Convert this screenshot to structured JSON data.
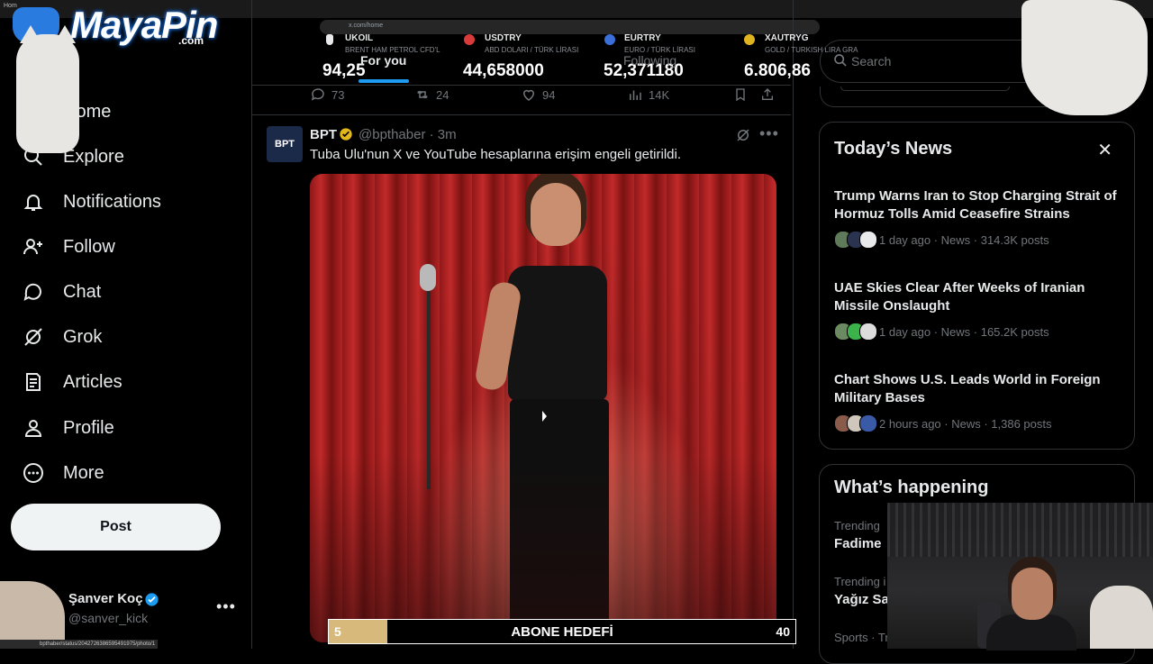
{
  "browser": {
    "tab_title": "Hom",
    "url": "x.com/home"
  },
  "overlay": {
    "logo_text": "MayaPin",
    "logo_sub": ".com",
    "goal": {
      "start": "5",
      "label": "ABONE HEDEFİ",
      "end": "40",
      "progress": 0.125
    },
    "status_url": "bpthaber/status/2042726386595491975/photo/1"
  },
  "tickers": [
    {
      "symbol": "UKOIL",
      "sub": "BRENT HAM PETROL CFD'L",
      "value": "94,25",
      "color": "#e7e9ea"
    },
    {
      "symbol": "USDTRY",
      "sub": "ABD DOLARI / TÜRK LİRASI",
      "value": "44,658000",
      "color": "#d93a3a"
    },
    {
      "symbol": "EURTRY",
      "sub": "EURO / TÜRK LİRASI",
      "value": "52,371180",
      "color": "#3a6fd9"
    },
    {
      "symbol": "XAUTRYG",
      "sub": "GOLD / TURKISH LIRA GRA",
      "value": "6.806,86",
      "color": "#e0b321"
    }
  ],
  "tabs": {
    "for_you": "For you",
    "following": "Following"
  },
  "nav": {
    "items": [
      {
        "label": "Home",
        "icon": "home-icon"
      },
      {
        "label": "Explore",
        "icon": "search-icon"
      },
      {
        "label": "Notifications",
        "icon": "bell-icon"
      },
      {
        "label": "Follow",
        "icon": "person-add-icon"
      },
      {
        "label": "Chat",
        "icon": "chat-icon"
      },
      {
        "label": "Grok",
        "icon": "grok-icon"
      },
      {
        "label": "Articles",
        "icon": "article-icon"
      },
      {
        "label": "Profile",
        "icon": "profile-icon"
      },
      {
        "label": "More",
        "icon": "more-circle-icon"
      }
    ],
    "post_label": "Post",
    "account": {
      "name": "Şanver Koç",
      "handle": "@sanver_kick"
    }
  },
  "prev_tweet_actions": {
    "replies": "73",
    "reposts": "24",
    "likes": "94",
    "views": "14K"
  },
  "tweet": {
    "avatar_text": "BPT",
    "name": "BPT",
    "handle_time": "@bpthaber · 3m",
    "text": "Tuba Ulu'nun X ve YouTube hesaplarına erişim engeli getirildi."
  },
  "search": {
    "placeholder": "Search"
  },
  "todays_news": {
    "title": "Today’s News",
    "items": [
      {
        "headline": "Trump Warns Iran to Stop Charging Strait of Hormuz Tolls Amid Ceasefire Strains",
        "meta": "1 day ago · News · 314.3K posts"
      },
      {
        "headline": "UAE Skies Clear After Weeks of Iranian Missile Onslaught",
        "meta": "1 day ago · News · 165.2K posts"
      },
      {
        "headline": "Chart Shows U.S. Leads World in Foreign Military Bases",
        "meta": "2 hours ago · News · 1,386 posts"
      }
    ]
  },
  "happening": {
    "title": "What’s happening",
    "trends": [
      {
        "context": "Trending",
        "name": "Fadime"
      },
      {
        "context": "Trending i",
        "name": "Yağız Sa"
      },
      {
        "context": "Sports · Tr",
        "name": ""
      }
    ]
  },
  "colors": {
    "accent": "#1d9bf0",
    "goal_fill": "#d7b97b",
    "verified_gold": "#e2b719",
    "verified_blue": "#1d9bf0"
  }
}
